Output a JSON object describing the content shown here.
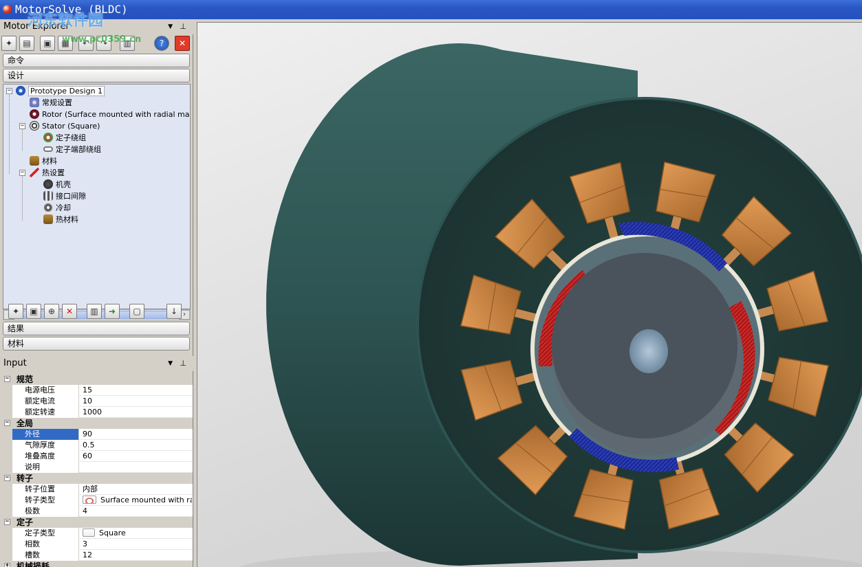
{
  "window": {
    "title": "MotorSolve (BLDC)"
  },
  "watermark": {
    "site": "河东软件园",
    "url": "www.pc0359.cn"
  },
  "explorer": {
    "title": "Motor Explorer",
    "commands_label": "命令",
    "design_label": "设计",
    "results_label": "结果",
    "materials_label": "材料",
    "tree": [
      {
        "label": "Prototype Design 1",
        "level": 0,
        "expanded": true,
        "icon": "design-icon"
      },
      {
        "label": "常规设置",
        "level": 1,
        "icon": "gear-settings-icon"
      },
      {
        "label": "Rotor (Surface mounted with radial magnets",
        "level": 1,
        "icon": "rotor-icon"
      },
      {
        "label": "Stator (Square)",
        "level": 1,
        "expanded": true,
        "icon": "stator-icon"
      },
      {
        "label": "定子绕组",
        "level": 2,
        "icon": "winding-icon"
      },
      {
        "label": "定子端部绕组",
        "level": 2,
        "icon": "end-winding-icon"
      },
      {
        "label": "材料",
        "level": 1,
        "icon": "material-icon"
      },
      {
        "label": "热设置",
        "level": 1,
        "expanded": true,
        "icon": "thermal-icon"
      },
      {
        "label": "机壳",
        "level": 2,
        "icon": "housing-icon"
      },
      {
        "label": "接口间隙",
        "level": 2,
        "icon": "interface-gap-icon"
      },
      {
        "label": "冷却",
        "level": 2,
        "icon": "cooling-icon"
      },
      {
        "label": "热材料",
        "level": 2,
        "icon": "thermal-material-icon"
      }
    ]
  },
  "input": {
    "title": "Input",
    "sections": [
      {
        "name": "规范",
        "rows": [
          {
            "name": "电源电压",
            "value": "15"
          },
          {
            "name": "额定电流",
            "value": "10"
          },
          {
            "name": "额定转速",
            "value": "1000"
          }
        ]
      },
      {
        "name": "全局",
        "rows": [
          {
            "name": "外径",
            "value": "90",
            "selected": true
          },
          {
            "name": "气隙厚度",
            "value": "0.5"
          },
          {
            "name": "堆叠高度",
            "value": "60"
          },
          {
            "name": "说明",
            "value": ""
          }
        ]
      },
      {
        "name": "转子",
        "rows": [
          {
            "name": "转子位置",
            "value": "内部"
          },
          {
            "name": "转子类型",
            "value": "Surface mounted with ra…"
          },
          {
            "name": "极数",
            "value": "4"
          }
        ]
      },
      {
        "name": "定子",
        "rows": [
          {
            "name": "定子类型",
            "value": "Square"
          },
          {
            "name": "相数",
            "value": "3"
          },
          {
            "name": "槽数",
            "value": "12"
          }
        ]
      },
      {
        "name": "机械损耗",
        "rows": []
      }
    ]
  },
  "colors": {
    "housing": "#2f5a58",
    "housing_face": "#223f3d",
    "coil": "#c98a4a",
    "magnet_red": "#b01818",
    "magnet_blue": "#1c2a9c",
    "rotor": "#4a535c",
    "selection": "#316ac5"
  }
}
